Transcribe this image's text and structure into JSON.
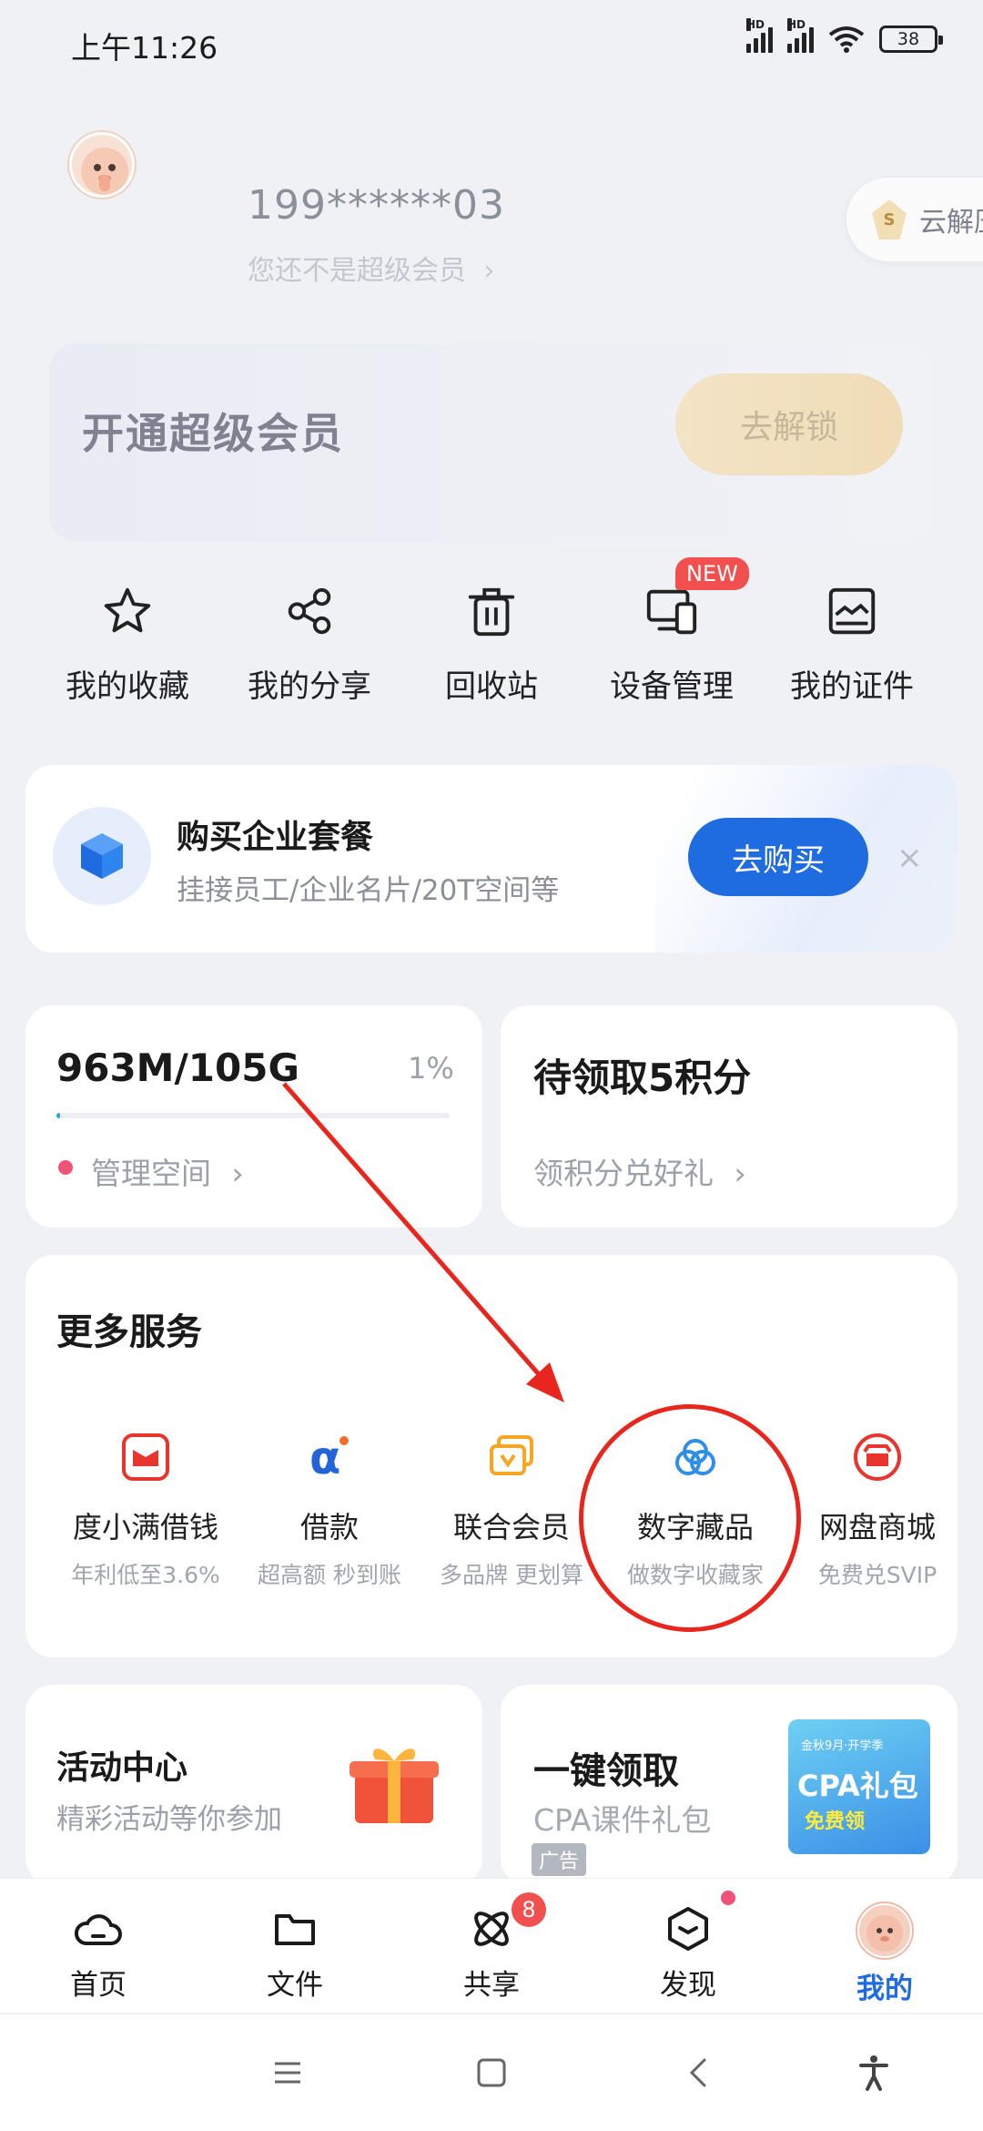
{
  "status_bar": {
    "time": "上午11:26",
    "signal1": "HD",
    "signal2": "HD",
    "battery": "38"
  },
  "profile": {
    "phone": "199******03",
    "membership_status": "您还不是超级会员",
    "cloud_pill": "云解压"
  },
  "vip_banner": {
    "title": "开通超级会员",
    "button": "去解锁"
  },
  "quick_actions": [
    {
      "label": "我的收藏",
      "icon": "star-icon"
    },
    {
      "label": "我的分享",
      "icon": "share-nodes-icon"
    },
    {
      "label": "回收站",
      "icon": "trash-icon"
    },
    {
      "label": "设备管理",
      "icon": "devices-icon",
      "badge": "NEW"
    },
    {
      "label": "我的证件",
      "icon": "id-card-icon"
    }
  ],
  "enterprise": {
    "title": "购买企业套餐",
    "subtitle": "挂接员工/企业名片/20T空间等",
    "button": "去购买",
    "close": "×"
  },
  "storage": {
    "usage": "963M/105G",
    "percent": "1%",
    "progress": 0.01,
    "link": "管理空间"
  },
  "points": {
    "title": "待领取5积分",
    "link": "领积分兑好礼"
  },
  "more_services": {
    "title": "更多服务",
    "items": [
      {
        "name": "度小满借钱",
        "desc": "年利低至3.6%",
        "icon": "du-loan-icon"
      },
      {
        "name": "借款",
        "desc": "超高额 秒到账",
        "icon": "loan-icon"
      },
      {
        "name": "联合会员",
        "desc": "多品牌 更划算",
        "icon": "joint-membership-icon"
      },
      {
        "name": "数字藏品",
        "desc": "做数字收藏家",
        "icon": "cloud-collection-icon"
      },
      {
        "name": "网盘商城",
        "desc": "免费兑SVIP",
        "icon": "mall-icon"
      }
    ]
  },
  "activity": {
    "title": "活动中心",
    "subtitle": "精彩活动等你参加"
  },
  "ad": {
    "title": "一键领取",
    "subtitle": "CPA课件礼包",
    "tag": "广告",
    "img_top": "金秋9月·开学季",
    "img_main": "CPA礼包",
    "img_bottom": "免费领"
  },
  "bottom_nav": [
    {
      "label": "首页",
      "icon": "cloud-home-icon"
    },
    {
      "label": "文件",
      "icon": "folder-icon"
    },
    {
      "label": "共享",
      "icon": "share-atom-icon",
      "badge": "8"
    },
    {
      "label": "发现",
      "icon": "discover-icon"
    },
    {
      "label": "我的",
      "icon": "avatar-icon",
      "active": true
    }
  ],
  "colors": {
    "accent": "#1f6be0",
    "badge_red": "#f24f4f",
    "annotation_red": "#e8261e"
  }
}
